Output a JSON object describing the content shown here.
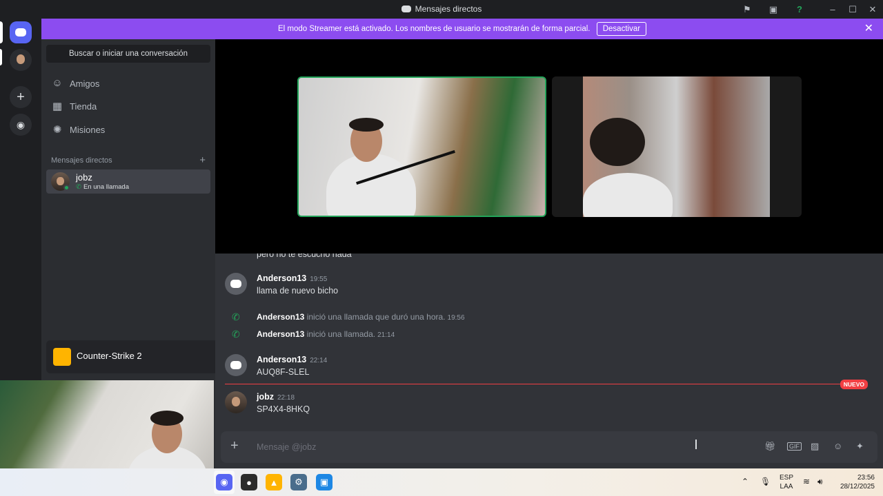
{
  "window": {
    "title": "Mensajes directos"
  },
  "banner": {
    "text": "El modo Streamer está activado. Los nombres de usuario se mostrarán de forma parcial.",
    "button": "Desactivar"
  },
  "sidebar": {
    "search_label": "Buscar o iniciar una conversación",
    "nav": [
      {
        "label": "Amigos",
        "icon": "friends-icon"
      },
      {
        "label": "Tienda",
        "icon": "shop-icon"
      },
      {
        "label": "Misiones",
        "icon": "quests-icon"
      }
    ],
    "dm_header": "Mensajes directos",
    "dm_item": {
      "name": "jobz",
      "status": "En una llamada"
    },
    "game": {
      "name": "Counter-Strike 2"
    }
  },
  "chat": {
    "partial_line": "pero no te escucho nada",
    "messages": [
      {
        "author": "Anderson13",
        "time": "19:55",
        "text": "llama de nuevo bicho"
      },
      {
        "author": "Anderson13",
        "time": "22:14",
        "text": "AUQ8F-SLEL"
      },
      {
        "author": "jobz",
        "time": "22:18",
        "text": "SP4X4-8HKQ"
      }
    ],
    "system": [
      {
        "author": "Anderson13",
        "text": "inició una llamada que duró una hora.",
        "time": "19:56"
      },
      {
        "author": "Anderson13",
        "text": "inició una llamada.",
        "time": "21:14"
      }
    ],
    "new_badge": "NUEVO",
    "composer_placeholder": "Mensaje @jobz"
  },
  "taskbar": {
    "lang_top": "ESP",
    "lang_bottom": "LAA",
    "time": "23:56",
    "date": "28/12/2025"
  },
  "colors": {
    "accent": "#5865f2",
    "streamer_banner": "#8c4cf0",
    "online": "#23a55a",
    "new": "#f23f43"
  }
}
